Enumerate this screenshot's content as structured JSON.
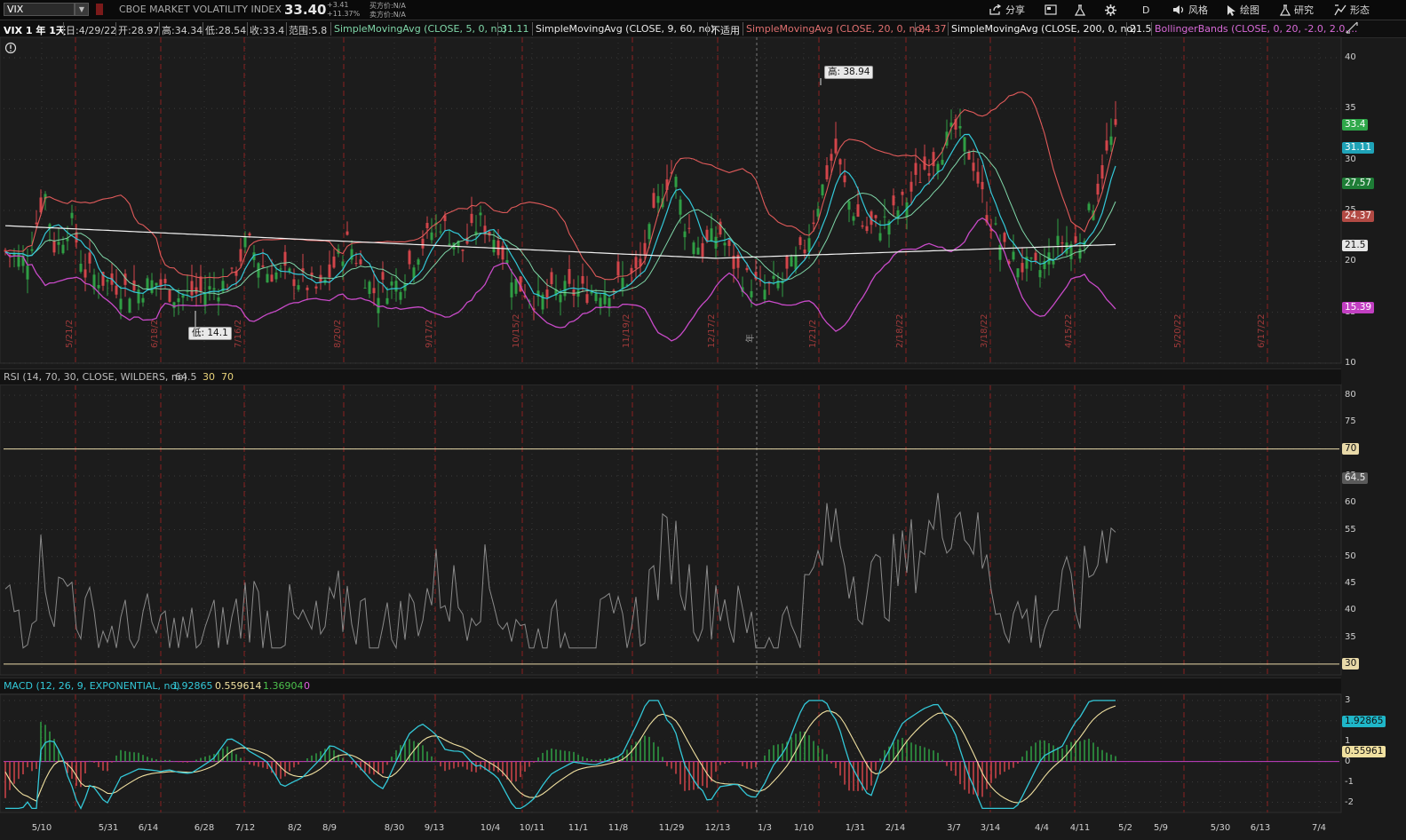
{
  "toolbar": {
    "symbol": "VIX",
    "description": "CBOE MARKET VOLATILITY INDEX",
    "last": "33.40",
    "change_abs": "+3.41",
    "change_pct": "+11.37%",
    "bid": "买方价:N/A",
    "ask": "卖方价:N/A",
    "buttons": {
      "share": "分享",
      "period": "D",
      "style": "风格",
      "drawing": "绘图",
      "study": "研究",
      "pattern": "形态"
    }
  },
  "infobar": {
    "title": "VIX 1 年 1天",
    "date": "日:4/29/22",
    "open": "开:28.97",
    "high": "高:34.34",
    "low": "低:28.54",
    "close": "收:33.4",
    "range": "范围:5.8",
    "sma5_label": "SimpleMovingAvg (CLOSE, 5, 0, no)",
    "sma5_val": "31.11",
    "sma9_label": "SimpleMovingAvg (CLOSE, 9, 60, no)",
    "sma9_val": "不适用",
    "sma20_label": "SimpleMovingAvg (CLOSE, 20, 0, no)",
    "sma20_val": "24.37",
    "sma200_label": "SimpleMovingAvg (CLOSE, 200, 0, no)",
    "sma200_val": "21.5",
    "bb_label": "BollingerBands (CLOSE, 0, 20, -2.0, 2.0,..."
  },
  "price_pane": {
    "high_bubble": "高: 38.94",
    "low_bubble": "低: 14.1",
    "axis_ticks": [
      "40",
      "35",
      "30",
      "25",
      "20",
      "15",
      "10"
    ],
    "axis_values": [
      40,
      35,
      30,
      25,
      20,
      15,
      10
    ],
    "price_tags": [
      {
        "text": "33.4",
        "value": 33.4,
        "bg": "#2fa84a",
        "fg": "#ffffff"
      },
      {
        "text": "31.11",
        "value": 31.11,
        "bg": "#1fa3b8",
        "fg": "#ffffff"
      },
      {
        "text": "27.57",
        "value": 27.57,
        "bg": "#1e7d36",
        "fg": "#ffffff"
      },
      {
        "text": "24.37",
        "value": 24.37,
        "bg": "#b24a44",
        "fg": "#ffffff"
      },
      {
        "text": "21.5",
        "value": 21.5,
        "bg": "#e6e6e6",
        "fg": "#111111"
      },
      {
        "text": "15.39",
        "value": 15.39,
        "bg": "#c23fc2",
        "fg": "#ffffff"
      }
    ],
    "expiry_labels": [
      "5/21/2",
      "6/18/2",
      "7/16/2",
      "8/20/2",
      "9/17/2",
      "10/15/2",
      "11/19/2",
      "12/17/2",
      "1/21/2",
      "2/18/22",
      "3/18/22",
      "4/15/22",
      "5/20/22",
      "6/17/22"
    ],
    "year_label": "年",
    "colors": {
      "up": "#2f9e44",
      "down": "#d2454a",
      "sma5": "#7fd6a8",
      "sma20": "#e05a5a",
      "sma9": "#33c8d8",
      "sma200": "#f2f2f2",
      "bb_lower": "#c84ac8"
    }
  },
  "rsi_pane": {
    "label": "RSI (14, 70, 30, CLOSE, WILDERS, no)",
    "value": "64.5",
    "os": "30",
    "ob": "70",
    "axis_ticks": [
      "80",
      "75",
      "70",
      "65",
      "60",
      "55",
      "50",
      "45",
      "40",
      "35"
    ],
    "axis_values": [
      80,
      75,
      70,
      65,
      60,
      55,
      50,
      45,
      40,
      35
    ],
    "tag_ob": "70",
    "tag_val": "64.5",
    "tag_os": "30"
  },
  "macd_pane": {
    "label": "MACD (12, 26, 9, EXPONENTIAL, no)",
    "value": "1.92865",
    "avg": "0.559614",
    "diff": "1.36904",
    "zero": "0",
    "axis_ticks": [
      "3",
      "2",
      "1",
      "0",
      "-1",
      "-2"
    ],
    "axis_values": [
      3,
      2,
      1,
      0,
      -1,
      -2
    ],
    "tag_value": "1.92865",
    "tag_avg": "0.55961"
  },
  "x_axis": {
    "dates": [
      "5/10",
      "5/31",
      "6/14",
      "6/28",
      "7/12",
      "8/2",
      "8/9",
      "8/30",
      "9/13",
      "10/4",
      "10/11",
      "11/1",
      "11/8",
      "11/29",
      "12/13",
      "1/3",
      "1/10",
      "1/31",
      "2/14",
      "3/7",
      "3/14",
      "4/4",
      "4/11",
      "5/2",
      "5/9",
      "5/30",
      "6/13",
      "7/4"
    ]
  },
  "chart_data": {
    "type": "candlestick",
    "title": "VIX 1 年 1天",
    "y_range": [
      10,
      42
    ],
    "high": 38.94,
    "low": 14.1,
    "last_close": 33.4,
    "close_path": [
      {
        "x": "5/10",
        "y": 21
      },
      {
        "x": "5/17",
        "y": 27
      },
      {
        "x": "5/31",
        "y": 19
      },
      {
        "x": "6/14",
        "y": 18
      },
      {
        "x": "6/28",
        "y": 16.5
      },
      {
        "x": "7/12",
        "y": 18
      },
      {
        "x": "7/19",
        "y": 22
      },
      {
        "x": "8/2",
        "y": 18.5
      },
      {
        "x": "8/9",
        "y": 17
      },
      {
        "x": "8/20",
        "y": 22
      },
      {
        "x": "8/30",
        "y": 17
      },
      {
        "x": "9/13",
        "y": 21
      },
      {
        "x": "9/20",
        "y": 24
      },
      {
        "x": "10/4",
        "y": 23
      },
      {
        "x": "10/11",
        "y": 18
      },
      {
        "x": "10/20",
        "y": 16
      },
      {
        "x": "11/1",
        "y": 17
      },
      {
        "x": "11/8",
        "y": 17.5
      },
      {
        "x": "11/19",
        "y": 19
      },
      {
        "x": "11/29",
        "y": 29
      },
      {
        "x": "12/6",
        "y": 22
      },
      {
        "x": "12/13",
        "y": 21
      },
      {
        "x": "12/20",
        "y": 23
      },
      {
        "x": "12/27",
        "y": 18
      },
      {
        "x": "1/3",
        "y": 17
      },
      {
        "x": "1/10",
        "y": 20
      },
      {
        "x": "1/18",
        "y": 27
      },
      {
        "x": "1/24",
        "y": 31
      },
      {
        "x": "1/31",
        "y": 24
      },
      {
        "x": "2/7",
        "y": 22
      },
      {
        "x": "2/14",
        "y": 26
      },
      {
        "x": "2/22",
        "y": 29
      },
      {
        "x": "3/1",
        "y": 31
      },
      {
        "x": "3/7",
        "y": 33
      },
      {
        "x": "3/14",
        "y": 30
      },
      {
        "x": "3/21",
        "y": 24
      },
      {
        "x": "3/28",
        "y": 20
      },
      {
        "x": "4/4",
        "y": 19
      },
      {
        "x": "4/11",
        "y": 22
      },
      {
        "x": "4/18",
        "y": 21
      },
      {
        "x": "4/25",
        "y": 28
      },
      {
        "x": "4/29",
        "y": 33.4
      }
    ]
  }
}
